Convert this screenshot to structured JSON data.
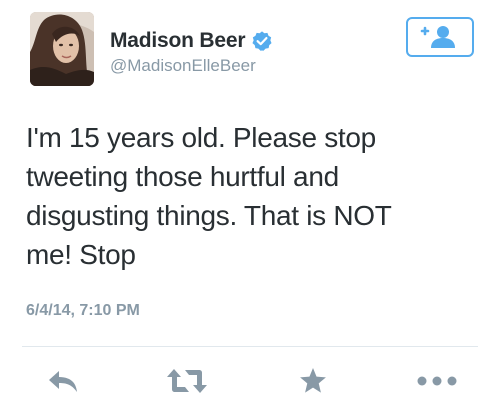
{
  "user": {
    "display_name": "Madison Beer",
    "handle": "@MadisonElleBeer",
    "verified": true
  },
  "tweet": {
    "text_lines": [
      "I'm 15 years old. Please stop",
      "tweeting those hurtful and",
      "disgusting things. That is NOT",
      "me! Stop"
    ],
    "timestamp": "6/4/14, 7:10 PM"
  },
  "icons": {
    "verified": "verified-badge-icon",
    "follow": "add-user-icon",
    "reply": "reply-icon",
    "retweet": "retweet-icon",
    "favorite": "star-icon",
    "more": "more-dots-icon"
  },
  "colors": {
    "accent": "#55acee",
    "text": "#292f33",
    "muted": "#8899a6",
    "icon_gray": "#8899a6",
    "divider": "#e1e8ed"
  }
}
